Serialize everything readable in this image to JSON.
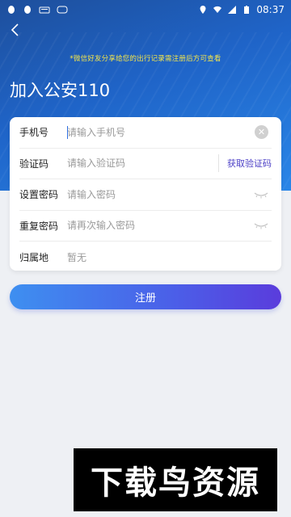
{
  "status_bar": {
    "time": "08:37",
    "left_icons": [
      "qq-icon",
      "qq-icon",
      "keyboard-icon",
      "tv-icon"
    ],
    "right_icons": [
      "location-icon",
      "wifi-icon",
      "signal-icon",
      "battery-icon"
    ]
  },
  "header": {
    "notice": "*微信好友分享给您的出行记录需注册后方可查看",
    "title": "加入公安110"
  },
  "form": {
    "phone": {
      "label": "手机号",
      "placeholder": "请输入手机号"
    },
    "code": {
      "label": "验证码",
      "placeholder": "请输入验证码",
      "button": "获取验证码"
    },
    "password": {
      "label": "设置密码",
      "placeholder": "请输入密码"
    },
    "repeat": {
      "label": "重复密码",
      "placeholder": "请再次输入密码"
    },
    "region": {
      "label": "归属地",
      "value": "暂无"
    }
  },
  "register_label": "注册",
  "watermark": "下载鸟资源",
  "colors": {
    "accent": "#4b3fc6",
    "notice": "#f4e54a",
    "header_top": "#1e4f9c",
    "header_bottom": "#2a86e8"
  }
}
